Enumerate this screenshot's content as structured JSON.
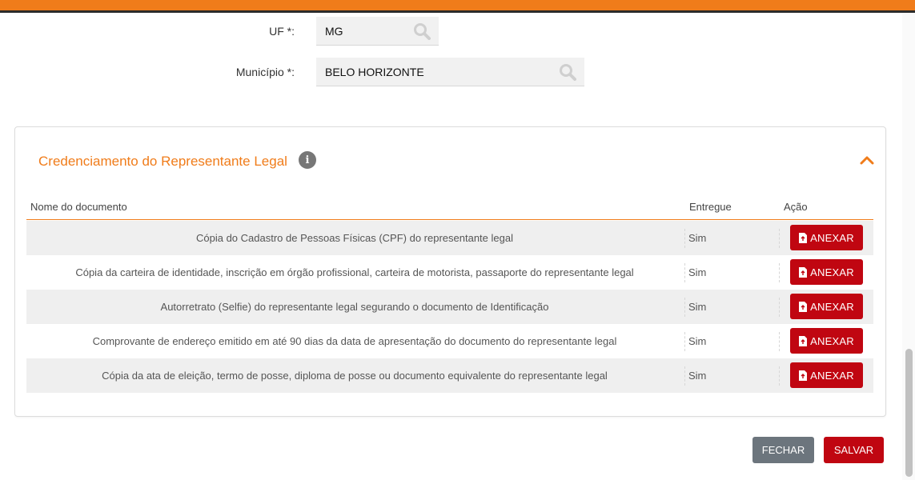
{
  "form": {
    "uf": {
      "label": "UF *:",
      "value": "MG"
    },
    "municipio": {
      "label": "Município *:",
      "value": "BELO HORIZONTE"
    }
  },
  "section": {
    "title": "Credenciamento do Representante Legal",
    "info_icon": "info-icon",
    "collapse_icon": "chevron-up-icon",
    "accent": "#f07c1a"
  },
  "table": {
    "headers": {
      "document": "Nome do documento",
      "delivered": "Entregue",
      "action": "Ação"
    },
    "rows": [
      {
        "document": "Cópia do Cadastro de Pessoas Físicas (CPF) do representante legal",
        "delivered": "Sim",
        "action": "ANEXAR"
      },
      {
        "document": "Cópia da carteira de identidade, inscrição em órgão profissional, carteira de motorista, passaporte do representante legal",
        "delivered": "Sim",
        "action": "ANEXAR"
      },
      {
        "document": "Autorretrato (Selfie) do representante legal segurando o documento de Identificação",
        "delivered": "Sim",
        "action": "ANEXAR"
      },
      {
        "document": "Comprovante de endereço emitido em até 90 dias da data de apresentação do documento do representante legal",
        "delivered": "Sim",
        "action": "ANEXAR"
      },
      {
        "document": "Cópia da ata de eleição, termo de posse, diploma de posse ou documento equivalente do representante legal",
        "delivered": "Sim",
        "action": "ANEXAR"
      }
    ]
  },
  "footer": {
    "close_label": "FECHAR",
    "save_label": "SALVAR"
  },
  "colors": {
    "primary": "#c00611",
    "secondary": "#6c757d",
    "accent": "#f07c1a"
  }
}
